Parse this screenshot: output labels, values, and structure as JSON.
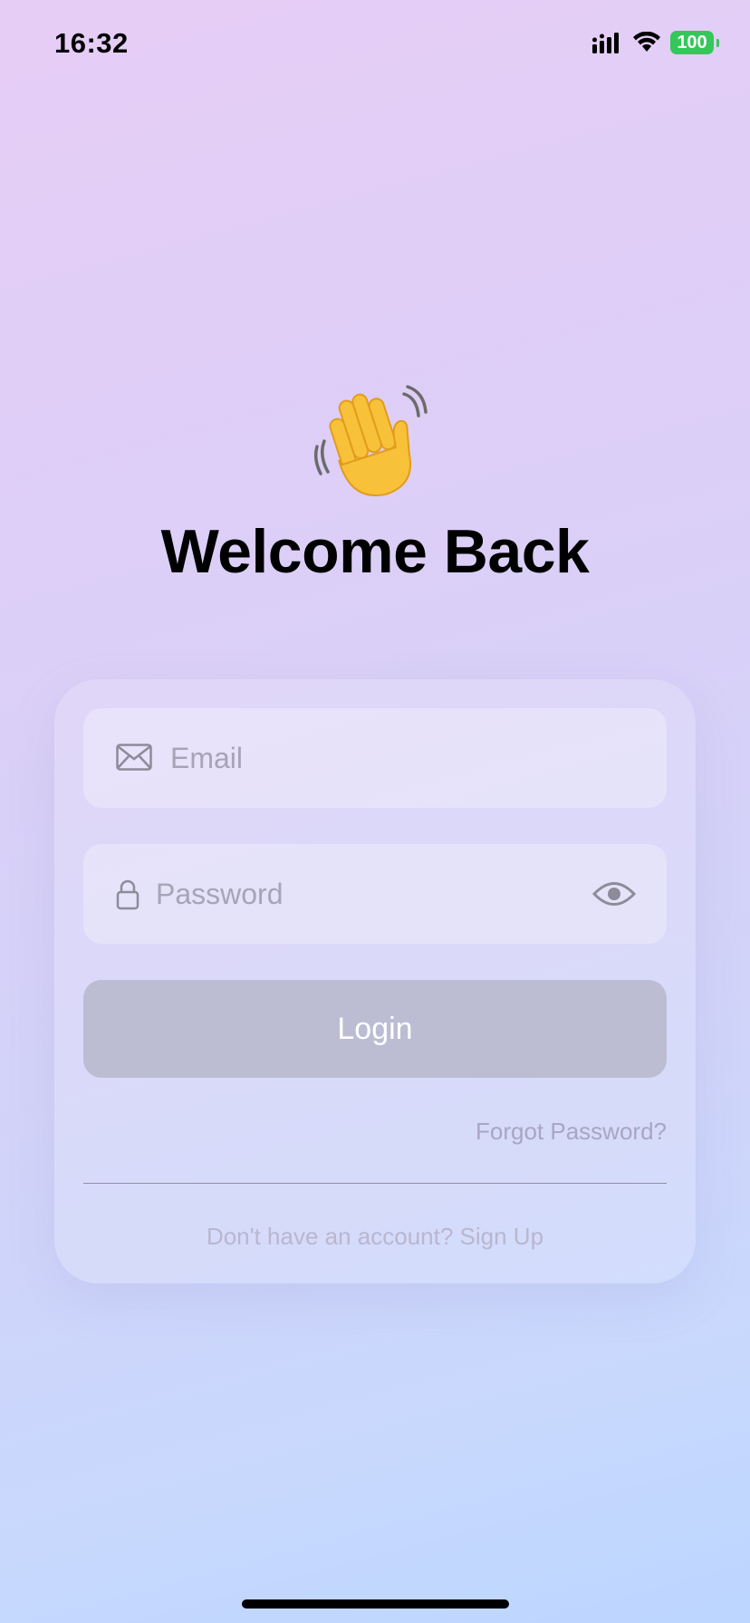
{
  "status_bar": {
    "time": "16:32",
    "battery_level": "100",
    "icons": [
      "signal-icon",
      "wifi-icon",
      "battery-icon"
    ]
  },
  "hero": {
    "emoji_icon": "waving-hand-icon",
    "title": "Welcome Back"
  },
  "form": {
    "email": {
      "placeholder": "Email",
      "value": "",
      "icon": "mail-icon"
    },
    "password": {
      "placeholder": "Password",
      "value": "",
      "icon": "lock-icon",
      "toggle_icon": "eye-icon"
    },
    "login_label": "Login",
    "forgot_password_label": "Forgot Password?",
    "signup_prompt": "Don't have an account? Sign Up"
  },
  "colors": {
    "battery": "#34c759",
    "button_disabled": "#bcbdd3",
    "link": "#a8a6c2"
  }
}
